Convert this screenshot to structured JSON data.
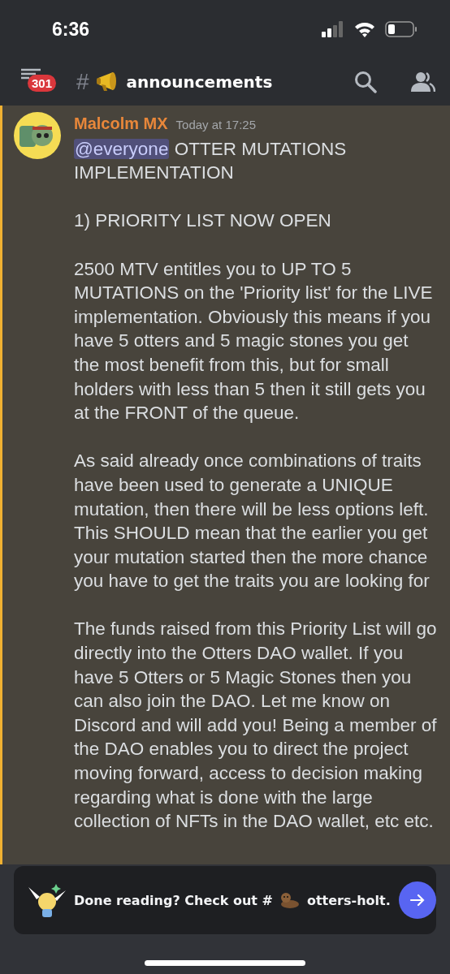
{
  "status_bar": {
    "time": "6:36"
  },
  "header": {
    "badge": "301",
    "hash": "#",
    "channel": "announcements"
  },
  "message": {
    "author": "Malcolm MX",
    "timestamp": "Today at 17:25",
    "mention": "@everyone",
    "paragraphs": [
      "OTTER MUTATIONS IMPLEMENTATION",
      "1) PRIORITY LIST NOW OPEN",
      "2500 MTV entitles you to UP TO 5 MUTATIONS on the 'Priority list' for the LIVE implementation. Obviously this means if you have 5 otters and 5 magic stones you get the most benefit from this, but for small holders with less than 5 then it still gets you at the FRONT of the queue.",
      "As said already once combinations of traits have been used to generate a UNIQUE mutation, then there will be less options left. This SHOULD mean that the earlier you get your mutation started then the more chance you have to get the traits you are looking for",
      "The funds raised from this Priority List will go directly into the Otters DAO wallet. If you have 5 Otters or 5 Magic Stones then you can also join the DAO. Let me know on Discord and will add you! Being a member of the DAO enables you to direct the project moving forward, access to decision making regarding what is done with the large collection of NFTs in the DAO wallet, etc etc."
    ]
  },
  "prompt": {
    "text": "Done reading? Check out #",
    "channel": "otters-holt."
  }
}
